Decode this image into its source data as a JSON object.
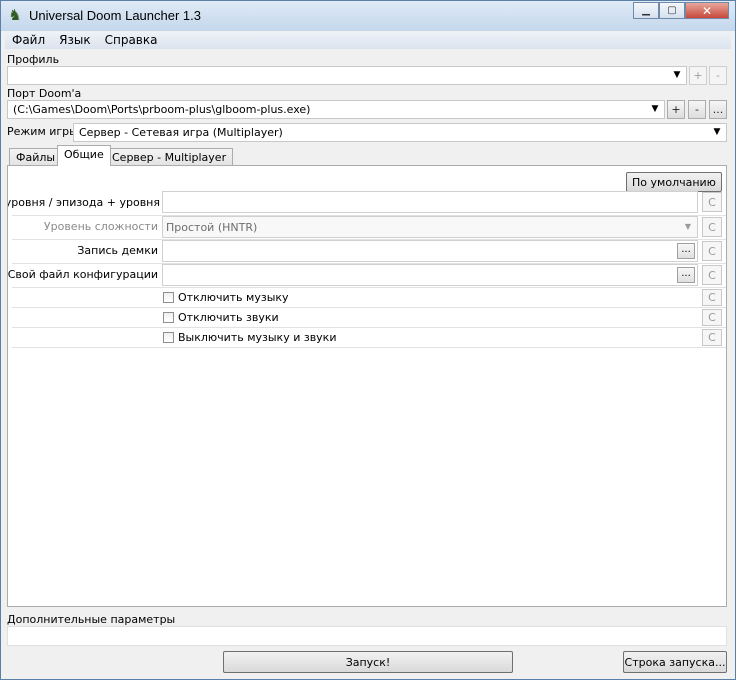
{
  "window": {
    "title": "Universal Doom Launcher 1.3"
  },
  "menu": [
    "Файл",
    "Язык",
    "Справка"
  ],
  "profile": {
    "label": "Профиль",
    "value": "",
    "add": "+",
    "remove": "-"
  },
  "port": {
    "label": "Порт Doom'a",
    "value": "(C:\\Games\\Doom\\Ports\\prboom-plus\\glboom-plus.exe)",
    "add": "+",
    "remove": "-",
    "browse": "..."
  },
  "mode": {
    "label": "Режим игры",
    "value": "Сервер - Сетевая игра (Multiplayer)"
  },
  "tabs": [
    "Файлы",
    "Общие",
    "Сервер - Multiplayer"
  ],
  "general": {
    "defaults_button": "По умолчанию",
    "rows": [
      {
        "label": "ер уровня / эпизода + уровня",
        "value": "",
        "clear": "C"
      },
      {
        "label": "Уровень сложности",
        "value": "Простой (HNTR)",
        "clear": "C"
      },
      {
        "label": "Запись демки",
        "value": "",
        "browse": "...",
        "clear": "C"
      },
      {
        "label": "Свой файл конфигурации",
        "value": "",
        "browse": "...",
        "clear": "C"
      }
    ],
    "checkboxes": [
      {
        "label": "Отключить музыку",
        "checked": false,
        "clear": "C"
      },
      {
        "label": "Отключить звуки",
        "checked": false,
        "clear": "C"
      },
      {
        "label": "Выключить музыку и звуки",
        "checked": false,
        "clear": "C"
      }
    ]
  },
  "extra": {
    "label": "Дополнительные параметры",
    "value": ""
  },
  "launch_button": "Запуск!",
  "cmdline_button": "Строка запуска...",
  "icons": {
    "app": "doom-launcher-icon",
    "dropdown": "chevron-down-icon",
    "minimize": "minimize-icon",
    "maximize": "maximize-icon",
    "close": "close-icon"
  }
}
